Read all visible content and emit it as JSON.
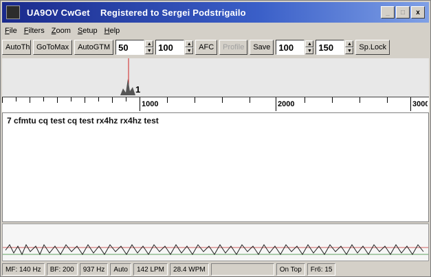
{
  "window": {
    "app_name": "UA9OV CwGet",
    "registration": "Registered to Sergei Podstrigailo"
  },
  "window_buttons": {
    "minimize": "_",
    "maximize": "□",
    "close": "x"
  },
  "menu": [
    "File",
    "Filters",
    "Zoom",
    "Setup",
    "Help"
  ],
  "toolbar": {
    "autothr_label": "AutoThr",
    "gotomax_label": "GoToMax",
    "autogtm_label": "AutoGTM",
    "spin1_value": "50",
    "spin2_value": "100",
    "afc_label": "AFC",
    "profile_label": "Profile",
    "save_label": "Save",
    "spin3_value": "100",
    "spin4_value": "150",
    "splock_label": "Sp.Lock"
  },
  "ruler": {
    "ticks": [
      "1000",
      "2000",
      "3000"
    ]
  },
  "spectrum": {
    "marker_label": "1"
  },
  "decoded_text": "7 cfmtu cq test cq test rx4hz rx4hz test",
  "statusbar": {
    "mf": "MF: 140 Hz",
    "bf": "BF: 200",
    "freq": "937 Hz",
    "mode": "Auto",
    "lpm": "142 LPM",
    "wpm": "28.4 WPM",
    "ontop": "On Top",
    "fr6": "Fr6: 15"
  }
}
